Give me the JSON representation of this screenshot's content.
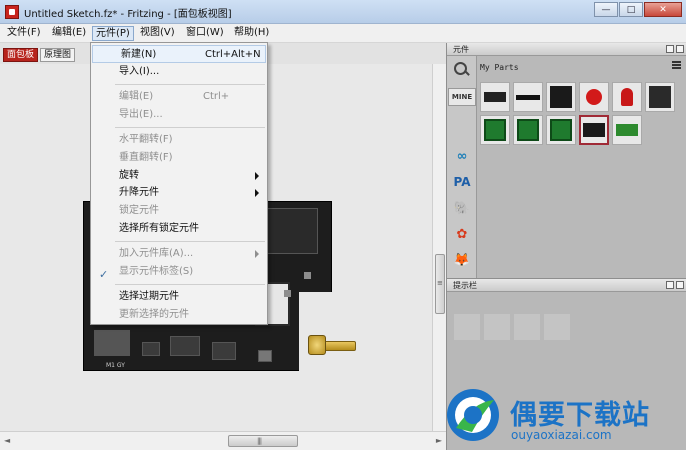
{
  "window": {
    "title": "Untitled Sketch.fz* - Fritzing - [面包板视图]",
    "min": "—",
    "max": "□",
    "close": "✕"
  },
  "menubar": {
    "items": [
      {
        "label": "文件(F)"
      },
      {
        "label": "编辑(E)"
      },
      {
        "label": "元件(P)"
      },
      {
        "label": "视图(V)"
      },
      {
        "label": "窗口(W)"
      },
      {
        "label": "帮助(H)"
      }
    ]
  },
  "view_tabs": {
    "breadboard": "面包板",
    "schematic": "原理图"
  },
  "part_menu": {
    "new": {
      "label": "新建(N)",
      "shortcut": "Ctrl+Alt+N"
    },
    "import": {
      "label": "导入(I)..."
    },
    "edit": {
      "label": "编辑(E)",
      "shortcut": "Ctrl+"
    },
    "export": {
      "label": "导出(E)..."
    },
    "flip_h": {
      "label": "水平翻转(F)"
    },
    "flip_v": {
      "label": "垂直翻转(F)"
    },
    "rotate": {
      "label": "旋转"
    },
    "raise_lower": {
      "label": "升降元件"
    },
    "lock": {
      "label": "锁定元件"
    },
    "select_locked": {
      "label": "选择所有锁定元件"
    },
    "add_to_bin": {
      "label": "加入元件库(A)..."
    },
    "show_labels": {
      "label": "显示元件标签(S)",
      "check": "✓"
    },
    "select_obsolete": {
      "label": "选择过期元件"
    },
    "update_selected": {
      "label": "更新选择的元件"
    }
  },
  "parts_panel": {
    "title": "元件",
    "bin_name": "My Parts",
    "mine_tab": "MINE",
    "bins": [
      "∞",
      "PA",
      "🐘",
      "✿",
      "🦊"
    ]
  },
  "hint_panel": {
    "title": "提示栏"
  },
  "canvas": {
    "pcb_label": "M1 GY"
  },
  "scrollbars": {
    "h_left": "◄",
    "h_right": "►",
    "grip": "|||",
    "v_grip": "≡"
  },
  "watermark": {
    "text": "偶要下载站",
    "url": "ouyaoxiazai.com"
  },
  "colors": {
    "accent": "#b7241d",
    "watermark": "#1c73c6",
    "pcb": "#1d1d1d"
  }
}
